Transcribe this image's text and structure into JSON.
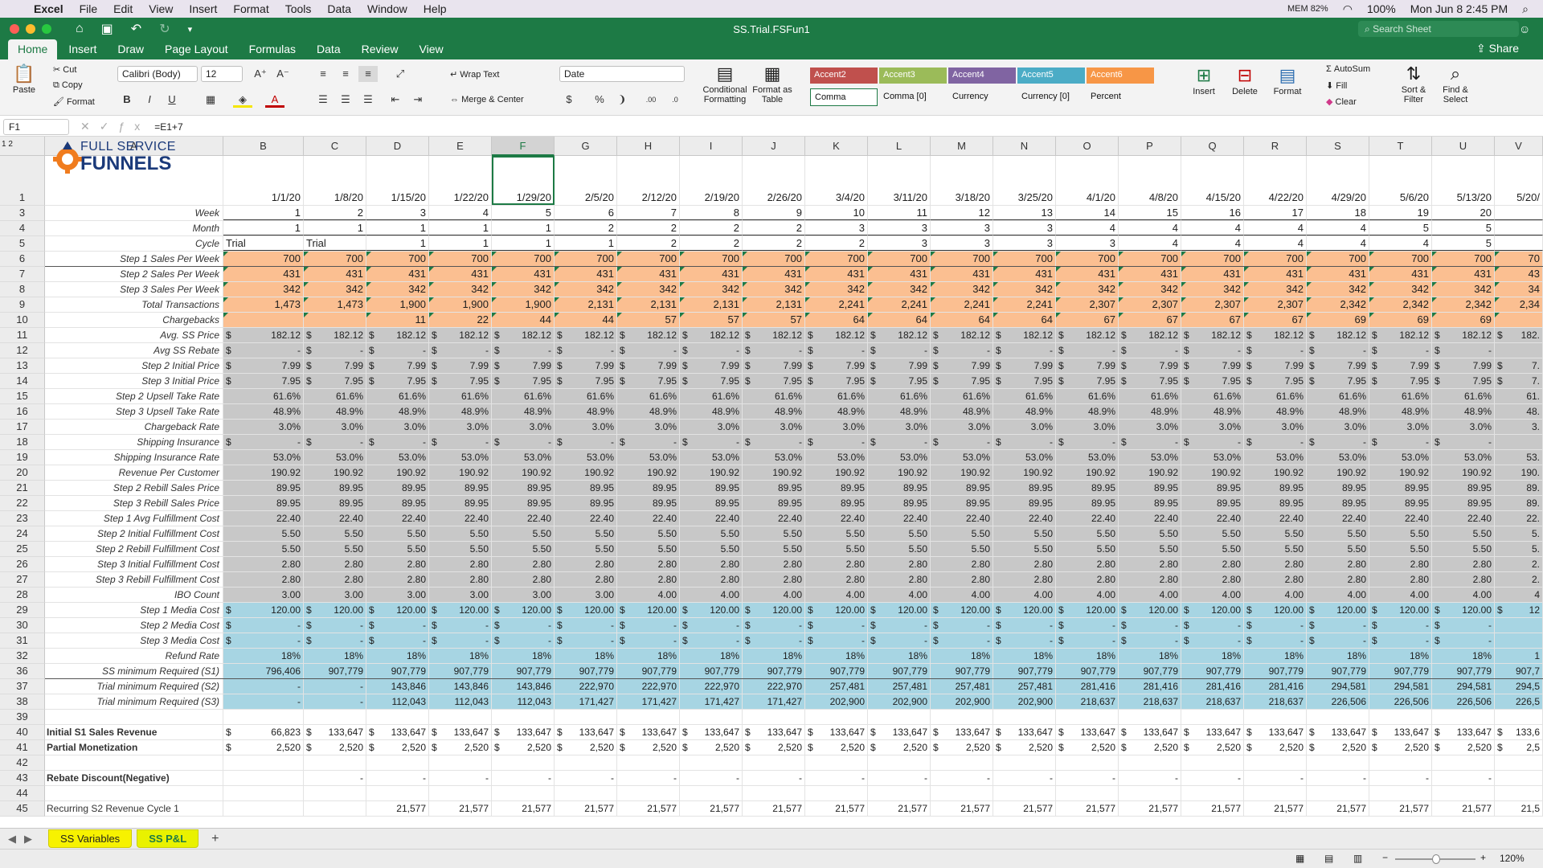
{
  "menubar": {
    "app": "Excel",
    "items": [
      "File",
      "Edit",
      "View",
      "Insert",
      "Format",
      "Tools",
      "Data",
      "Window",
      "Help"
    ],
    "mem": "MEM 82%",
    "battery": "100%",
    "datetime": "Mon Jun 8  2:45 PM"
  },
  "window": {
    "title": "SS.Trial.FSFun1",
    "search_placeholder": "Search Sheet",
    "share": "Share"
  },
  "tabs": [
    "Home",
    "Insert",
    "Draw",
    "Page Layout",
    "Formulas",
    "Data",
    "Review",
    "View"
  ],
  "ribbon": {
    "paste": "Paste",
    "cut": "Cut",
    "copy": "Copy",
    "format": "Format",
    "font": "Calibri (Body)",
    "size": "12",
    "wrap": "Wrap Text",
    "merge": "Merge & Center",
    "numfmt": "Date",
    "cond": "Conditional Formatting",
    "fmt_table": "Format as Table",
    "styles": [
      {
        "label": "Accent2",
        "color": "#c0504d"
      },
      {
        "label": "Accent3",
        "color": "#9bbb59"
      },
      {
        "label": "Accent4",
        "color": "#8064a2"
      },
      {
        "label": "Accent5",
        "color": "#4bacc6"
      },
      {
        "label": "Accent6",
        "color": "#f79646"
      }
    ],
    "styles2": [
      "Comma",
      "Comma [0]",
      "Currency",
      "Currency [0]",
      "Percent"
    ],
    "insert": "Insert",
    "delete": "Delete",
    "format2": "Format",
    "autosum": "AutoSum",
    "fill": "Fill",
    "clear": "Clear",
    "sort": "Sort & Filter",
    "find": "Find & Select"
  },
  "formula_bar": {
    "cell": "F1",
    "formula": "=E1+7"
  },
  "logo": {
    "line1": "FULL SERVICE",
    "line2": "FUNNELS"
  },
  "columns": [
    "A",
    "B",
    "C",
    "D",
    "E",
    "F",
    "G",
    "H",
    "I",
    "J",
    "K",
    "L",
    "M",
    "N",
    "O",
    "P",
    "Q",
    "R",
    "S",
    "T",
    "U",
    "V"
  ],
  "rownums": [
    "1",
    "3",
    "4",
    "5",
    "6",
    "7",
    "8",
    "9",
    "10",
    "11",
    "12",
    "13",
    "14",
    "15",
    "16",
    "17",
    "18",
    "19",
    "20",
    "21",
    "22",
    "23",
    "24",
    "25",
    "26",
    "27",
    "28",
    "29",
    "30",
    "31",
    "32",
    "36",
    "37",
    "38",
    "39",
    "40",
    "41",
    "42",
    "43",
    "44",
    "45"
  ],
  "dates": [
    "1/1/20",
    "1/8/20",
    "1/15/20",
    "1/22/20",
    "1/29/20",
    "2/5/20",
    "2/12/20",
    "2/19/20",
    "2/26/20",
    "3/4/20",
    "3/11/20",
    "3/18/20",
    "3/25/20",
    "4/1/20",
    "4/8/20",
    "4/15/20",
    "4/22/20",
    "4/29/20",
    "5/6/20",
    "5/13/20",
    "5/20/"
  ],
  "rows": [
    {
      "label": "Week",
      "style": "",
      "vals": [
        "1",
        "2",
        "3",
        "4",
        "5",
        "6",
        "7",
        "8",
        "9",
        "10",
        "11",
        "12",
        "13",
        "14",
        "15",
        "16",
        "17",
        "18",
        "19",
        "20",
        ""
      ]
    },
    {
      "label": "Month",
      "style": "",
      "vals": [
        "1",
        "1",
        "1",
        "1",
        "1",
        "2",
        "2",
        "2",
        "2",
        "3",
        "3",
        "3",
        "3",
        "4",
        "4",
        "4",
        "4",
        "4",
        "5",
        "5",
        ""
      ]
    },
    {
      "label": "Cycle",
      "style": "",
      "vals": [
        "Trial",
        "Trial",
        "1",
        "1",
        "1",
        "1",
        "2",
        "2",
        "2",
        "2",
        "3",
        "3",
        "3",
        "3",
        "4",
        "4",
        "4",
        "4",
        "4",
        "5",
        ""
      ]
    },
    {
      "label": "Step 1 Sales Per Week",
      "style": "orange",
      "vals": [
        "700",
        "700",
        "700",
        "700",
        "700",
        "700",
        "700",
        "700",
        "700",
        "700",
        "700",
        "700",
        "700",
        "700",
        "700",
        "700",
        "700",
        "700",
        "700",
        "700",
        "70"
      ]
    },
    {
      "label": "Step 2 Sales Per Week",
      "style": "orange",
      "vals": [
        "431",
        "431",
        "431",
        "431",
        "431",
        "431",
        "431",
        "431",
        "431",
        "431",
        "431",
        "431",
        "431",
        "431",
        "431",
        "431",
        "431",
        "431",
        "431",
        "431",
        "43"
      ]
    },
    {
      "label": "Step 3 Sales Per Week",
      "style": "orange",
      "vals": [
        "342",
        "342",
        "342",
        "342",
        "342",
        "342",
        "342",
        "342",
        "342",
        "342",
        "342",
        "342",
        "342",
        "342",
        "342",
        "342",
        "342",
        "342",
        "342",
        "342",
        "34"
      ]
    },
    {
      "label": "Total Transactions",
      "style": "orange",
      "vals": [
        "1,473",
        "1,473",
        "1,900",
        "1,900",
        "1,900",
        "2,131",
        "2,131",
        "2,131",
        "2,131",
        "2,241",
        "2,241",
        "2,241",
        "2,241",
        "2,307",
        "2,307",
        "2,307",
        "2,307",
        "2,342",
        "2,342",
        "2,342",
        "2,34"
      ]
    },
    {
      "label": "Chargebacks",
      "style": "orange",
      "vals": [
        "",
        "",
        "11",
        "22",
        "44",
        "44",
        "57",
        "57",
        "57",
        "64",
        "64",
        "64",
        "64",
        "67",
        "67",
        "67",
        "67",
        "69",
        "69",
        "69",
        ""
      ]
    },
    {
      "label": "Avg. SS Price",
      "style": "gray",
      "dollar": true,
      "vals": [
        "182.12",
        "182.12",
        "182.12",
        "182.12",
        "182.12",
        "182.12",
        "182.12",
        "182.12",
        "182.12",
        "182.12",
        "182.12",
        "182.12",
        "182.12",
        "182.12",
        "182.12",
        "182.12",
        "182.12",
        "182.12",
        "182.12",
        "182.12",
        "182."
      ]
    },
    {
      "label": "Avg SS Rebate",
      "style": "gray",
      "dollar": true,
      "vals": [
        "-",
        "-",
        "-",
        "-",
        "-",
        "-",
        "-",
        "-",
        "-",
        "-",
        "-",
        "-",
        "-",
        "-",
        "-",
        "-",
        "-",
        "-",
        "-",
        "-",
        ""
      ]
    },
    {
      "label": "Step 2 Initial Price",
      "style": "gray",
      "dollar": true,
      "vals": [
        "7.99",
        "7.99",
        "7.99",
        "7.99",
        "7.99",
        "7.99",
        "7.99",
        "7.99",
        "7.99",
        "7.99",
        "7.99",
        "7.99",
        "7.99",
        "7.99",
        "7.99",
        "7.99",
        "7.99",
        "7.99",
        "7.99",
        "7.99",
        "7."
      ]
    },
    {
      "label": "Step 3 Initial Price",
      "style": "gray",
      "dollar": true,
      "vals": [
        "7.95",
        "7.95",
        "7.95",
        "7.95",
        "7.95",
        "7.95",
        "7.95",
        "7.95",
        "7.95",
        "7.95",
        "7.95",
        "7.95",
        "7.95",
        "7.95",
        "7.95",
        "7.95",
        "7.95",
        "7.95",
        "7.95",
        "7.95",
        "7."
      ]
    },
    {
      "label": "Step 2 Upsell Take Rate",
      "style": "gray",
      "vals": [
        "61.6%",
        "61.6%",
        "61.6%",
        "61.6%",
        "61.6%",
        "61.6%",
        "61.6%",
        "61.6%",
        "61.6%",
        "61.6%",
        "61.6%",
        "61.6%",
        "61.6%",
        "61.6%",
        "61.6%",
        "61.6%",
        "61.6%",
        "61.6%",
        "61.6%",
        "61.6%",
        "61."
      ]
    },
    {
      "label": "Step 3 Upsell Take Rate",
      "style": "gray",
      "vals": [
        "48.9%",
        "48.9%",
        "48.9%",
        "48.9%",
        "48.9%",
        "48.9%",
        "48.9%",
        "48.9%",
        "48.9%",
        "48.9%",
        "48.9%",
        "48.9%",
        "48.9%",
        "48.9%",
        "48.9%",
        "48.9%",
        "48.9%",
        "48.9%",
        "48.9%",
        "48.9%",
        "48."
      ]
    },
    {
      "label": "Chargeback Rate",
      "style": "gray",
      "vals": [
        "3.0%",
        "3.0%",
        "3.0%",
        "3.0%",
        "3.0%",
        "3.0%",
        "3.0%",
        "3.0%",
        "3.0%",
        "3.0%",
        "3.0%",
        "3.0%",
        "3.0%",
        "3.0%",
        "3.0%",
        "3.0%",
        "3.0%",
        "3.0%",
        "3.0%",
        "3.0%",
        "3."
      ]
    },
    {
      "label": "Shipping Insurance",
      "style": "gray",
      "dollar": true,
      "vals": [
        "-",
        "-",
        "-",
        "-",
        "-",
        "-",
        "-",
        "-",
        "-",
        "-",
        "-",
        "-",
        "-",
        "-",
        "-",
        "-",
        "-",
        "-",
        "-",
        "-",
        ""
      ]
    },
    {
      "label": "Shipping Insurance Rate",
      "style": "gray",
      "vals": [
        "53.0%",
        "53.0%",
        "53.0%",
        "53.0%",
        "53.0%",
        "53.0%",
        "53.0%",
        "53.0%",
        "53.0%",
        "53.0%",
        "53.0%",
        "53.0%",
        "53.0%",
        "53.0%",
        "53.0%",
        "53.0%",
        "53.0%",
        "53.0%",
        "53.0%",
        "53.0%",
        "53."
      ]
    },
    {
      "label": "Revenue Per Customer",
      "style": "gray",
      "vals": [
        "190.92",
        "190.92",
        "190.92",
        "190.92",
        "190.92",
        "190.92",
        "190.92",
        "190.92",
        "190.92",
        "190.92",
        "190.92",
        "190.92",
        "190.92",
        "190.92",
        "190.92",
        "190.92",
        "190.92",
        "190.92",
        "190.92",
        "190.92",
        "190."
      ]
    },
    {
      "label": "Step 2 Rebill Sales Price",
      "style": "gray",
      "vals": [
        "89.95",
        "89.95",
        "89.95",
        "89.95",
        "89.95",
        "89.95",
        "89.95",
        "89.95",
        "89.95",
        "89.95",
        "89.95",
        "89.95",
        "89.95",
        "89.95",
        "89.95",
        "89.95",
        "89.95",
        "89.95",
        "89.95",
        "89.95",
        "89."
      ]
    },
    {
      "label": "Step 3 Rebill Sales Price",
      "style": "gray",
      "vals": [
        "89.95",
        "89.95",
        "89.95",
        "89.95",
        "89.95",
        "89.95",
        "89.95",
        "89.95",
        "89.95",
        "89.95",
        "89.95",
        "89.95",
        "89.95",
        "89.95",
        "89.95",
        "89.95",
        "89.95",
        "89.95",
        "89.95",
        "89.95",
        "89."
      ]
    },
    {
      "label": "Step 1 Avg Fulfillment Cost",
      "style": "gray",
      "vals": [
        "22.40",
        "22.40",
        "22.40",
        "22.40",
        "22.40",
        "22.40",
        "22.40",
        "22.40",
        "22.40",
        "22.40",
        "22.40",
        "22.40",
        "22.40",
        "22.40",
        "22.40",
        "22.40",
        "22.40",
        "22.40",
        "22.40",
        "22.40",
        "22."
      ]
    },
    {
      "label": "Step 2 Initial Fulfillment Cost",
      "style": "gray",
      "vals": [
        "5.50",
        "5.50",
        "5.50",
        "5.50",
        "5.50",
        "5.50",
        "5.50",
        "5.50",
        "5.50",
        "5.50",
        "5.50",
        "5.50",
        "5.50",
        "5.50",
        "5.50",
        "5.50",
        "5.50",
        "5.50",
        "5.50",
        "5.50",
        "5."
      ]
    },
    {
      "label": "Step 2 Rebill Fulfillment Cost",
      "style": "gray",
      "vals": [
        "5.50",
        "5.50",
        "5.50",
        "5.50",
        "5.50",
        "5.50",
        "5.50",
        "5.50",
        "5.50",
        "5.50",
        "5.50",
        "5.50",
        "5.50",
        "5.50",
        "5.50",
        "5.50",
        "5.50",
        "5.50",
        "5.50",
        "5.50",
        "5."
      ]
    },
    {
      "label": "Step 3 Initial Fulfillment Cost",
      "style": "gray",
      "vals": [
        "2.80",
        "2.80",
        "2.80",
        "2.80",
        "2.80",
        "2.80",
        "2.80",
        "2.80",
        "2.80",
        "2.80",
        "2.80",
        "2.80",
        "2.80",
        "2.80",
        "2.80",
        "2.80",
        "2.80",
        "2.80",
        "2.80",
        "2.80",
        "2."
      ]
    },
    {
      "label": "Step 3 Rebill Fulfillment Cost",
      "style": "gray",
      "vals": [
        "2.80",
        "2.80",
        "2.80",
        "2.80",
        "2.80",
        "2.80",
        "2.80",
        "2.80",
        "2.80",
        "2.80",
        "2.80",
        "2.80",
        "2.80",
        "2.80",
        "2.80",
        "2.80",
        "2.80",
        "2.80",
        "2.80",
        "2.80",
        "2."
      ]
    },
    {
      "label": "IBO Count",
      "style": "gray",
      "vals": [
        "3.00",
        "3.00",
        "3.00",
        "3.00",
        "3.00",
        "3.00",
        "4.00",
        "4.00",
        "4.00",
        "4.00",
        "4.00",
        "4.00",
        "4.00",
        "4.00",
        "4.00",
        "4.00",
        "4.00",
        "4.00",
        "4.00",
        "4.00",
        "4"
      ]
    },
    {
      "label": "Step 1 Media Cost",
      "style": "blue",
      "dollar": true,
      "vals": [
        "120.00",
        "120.00",
        "120.00",
        "120.00",
        "120.00",
        "120.00",
        "120.00",
        "120.00",
        "120.00",
        "120.00",
        "120.00",
        "120.00",
        "120.00",
        "120.00",
        "120.00",
        "120.00",
        "120.00",
        "120.00",
        "120.00",
        "120.00",
        "12"
      ]
    },
    {
      "label": "Step 2 Media Cost",
      "style": "blue",
      "dollar": true,
      "vals": [
        "-",
        "-",
        "-",
        "-",
        "-",
        "-",
        "-",
        "-",
        "-",
        "-",
        "-",
        "-",
        "-",
        "-",
        "-",
        "-",
        "-",
        "-",
        "-",
        "-",
        ""
      ]
    },
    {
      "label": "Step 3 Media Cost",
      "style": "blue",
      "dollar": true,
      "vals": [
        "-",
        "-",
        "-",
        "-",
        "-",
        "-",
        "-",
        "-",
        "-",
        "-",
        "-",
        "-",
        "-",
        "-",
        "-",
        "-",
        "-",
        "-",
        "-",
        "-",
        ""
      ]
    },
    {
      "label": "Refund Rate",
      "style": "blue",
      "vals": [
        "18%",
        "18%",
        "18%",
        "18%",
        "18%",
        "18%",
        "18%",
        "18%",
        "18%",
        "18%",
        "18%",
        "18%",
        "18%",
        "18%",
        "18%",
        "18%",
        "18%",
        "18%",
        "18%",
        "18%",
        "1"
      ]
    },
    {
      "label": "SS minimum Required (S1)",
      "style": "blue",
      "vals": [
        "796,406",
        "907,779",
        "907,779",
        "907,779",
        "907,779",
        "907,779",
        "907,779",
        "907,779",
        "907,779",
        "907,779",
        "907,779",
        "907,779",
        "907,779",
        "907,779",
        "907,779",
        "907,779",
        "907,779",
        "907,779",
        "907,779",
        "907,779",
        "907,7"
      ]
    },
    {
      "label": "Trial minimum Required (S2)",
      "style": "blue",
      "vals": [
        "-",
        "-",
        "143,846",
        "143,846",
        "143,846",
        "222,970",
        "222,970",
        "222,970",
        "222,970",
        "257,481",
        "257,481",
        "257,481",
        "257,481",
        "281,416",
        "281,416",
        "281,416",
        "281,416",
        "294,581",
        "294,581",
        "294,581",
        "294,5"
      ]
    },
    {
      "label": "Trial minimum Required (S3)",
      "style": "blue",
      "vals": [
        "-",
        "-",
        "112,043",
        "112,043",
        "112,043",
        "171,427",
        "171,427",
        "171,427",
        "171,427",
        "202,900",
        "202,900",
        "202,900",
        "202,900",
        "218,637",
        "218,637",
        "218,637",
        "218,637",
        "226,506",
        "226,506",
        "226,506",
        "226,5"
      ]
    },
    {
      "label": "",
      "style": "",
      "vals": []
    },
    {
      "label": "Initial S1 Sales Revenue",
      "style": "bold",
      "dollar": true,
      "vals": [
        "66,823",
        "133,647",
        "133,647",
        "133,647",
        "133,647",
        "133,647",
        "133,647",
        "133,647",
        "133,647",
        "133,647",
        "133,647",
        "133,647",
        "133,647",
        "133,647",
        "133,647",
        "133,647",
        "133,647",
        "133,647",
        "133,647",
        "133,647",
        "133,6"
      ]
    },
    {
      "label": "Partial Monetization",
      "style": "bold",
      "dollar": true,
      "vals": [
        "2,520",
        "2,520",
        "2,520",
        "2,520",
        "2,520",
        "2,520",
        "2,520",
        "2,520",
        "2,520",
        "2,520",
        "2,520",
        "2,520",
        "2,520",
        "2,520",
        "2,520",
        "2,520",
        "2,520",
        "2,520",
        "2,520",
        "2,520",
        "2,5"
      ]
    },
    {
      "label": "",
      "style": "",
      "vals": []
    },
    {
      "label": "Rebate Discount(Negative)",
      "style": "bold",
      "vals": [
        "",
        "-",
        "-",
        "-",
        "-",
        "-",
        "-",
        "-",
        "-",
        "-",
        "-",
        "-",
        "-",
        "-",
        "-",
        "-",
        "-",
        "-",
        "-",
        "-",
        ""
      ]
    },
    {
      "label": "",
      "style": "",
      "vals": []
    },
    {
      "label": "Recurring S2 Revenue Cycle 1",
      "style": "plain",
      "vals": [
        "",
        "",
        "21,577",
        "21,577",
        "21,577",
        "21,577",
        "21,577",
        "21,577",
        "21,577",
        "21,577",
        "21,577",
        "21,577",
        "21,577",
        "21,577",
        "21,577",
        "21,577",
        "21,577",
        "21,577",
        "21,577",
        "21,577",
        "21,5"
      ]
    }
  ],
  "sheets": [
    "SS Variables",
    "SS P&L"
  ],
  "zoom": "120%"
}
